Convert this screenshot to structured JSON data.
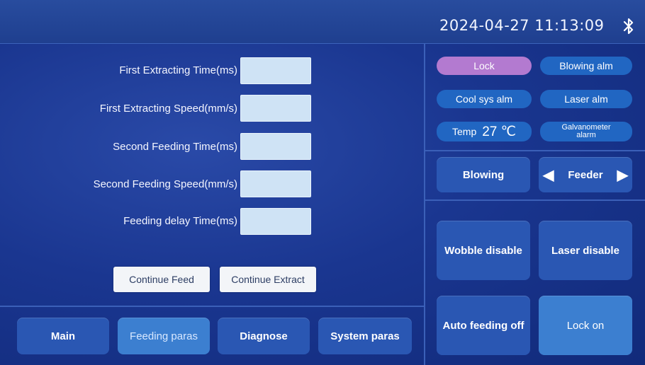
{
  "status_bar": {
    "datetime": "2024-04-27 11:13:09",
    "bluetooth_icon": "bluetooth-icon"
  },
  "params": [
    {
      "label": "First Extracting Time(ms)",
      "value": ""
    },
    {
      "label": "First Extracting Speed(mm/s)",
      "value": ""
    },
    {
      "label": "Second Feeding Time(ms)",
      "value": ""
    },
    {
      "label": "Second Feeding Speed(mm/s)",
      "value": ""
    },
    {
      "label": "Feeding delay Time(ms)",
      "value": ""
    }
  ],
  "actions": {
    "continue_feed": "Continue Feed",
    "continue_extract": "Continue Extract"
  },
  "nav": {
    "main": "Main",
    "feeding_paras": "Feeding paras",
    "diagnose": "Diagnose",
    "system_paras": "System paras",
    "active": "Feeding paras"
  },
  "alarms": {
    "lock": "Lock",
    "blowing_alm": "Blowing alm",
    "cool_sys_alm": "Cool sys alm",
    "laser_alm": "Laser alm",
    "temp_label": "Temp",
    "temp_value": "27 ℃",
    "galvanometer_alarm_line1": "Galvanometer",
    "galvanometer_alarm_line2": "alarm"
  },
  "controls": {
    "blowing": "Blowing",
    "feeder": "Feeder",
    "wobble_disable": "Wobble disable",
    "laser_disable": "Laser disable",
    "auto_feeding_off": "Auto feeding off",
    "lock_on": "Lock on"
  },
  "colors": {
    "background": "#1a3690",
    "button": "#2a57b3",
    "button_active": "#3c7fd0",
    "pill": "#2166c2",
    "lock_pill": "#b37ad0",
    "input": "#cfe3f5"
  }
}
